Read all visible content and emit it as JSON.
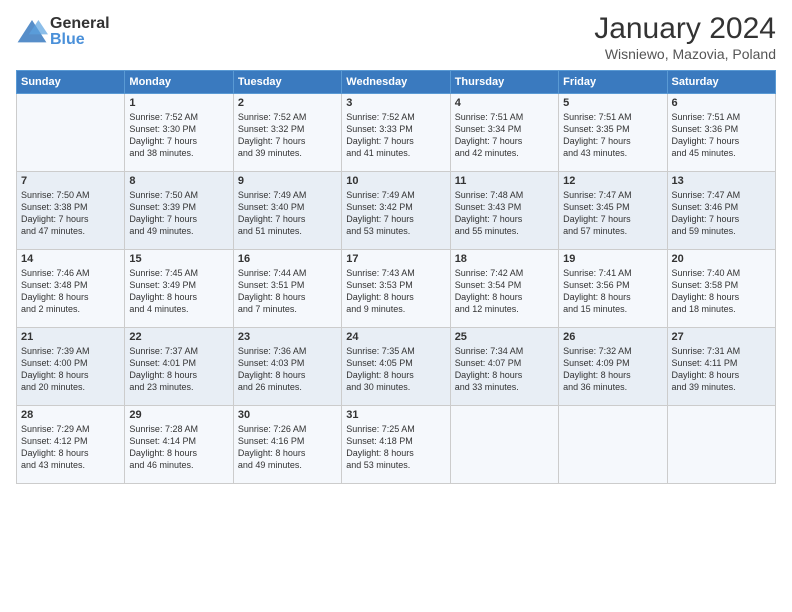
{
  "logo": {
    "general": "General",
    "blue": "Blue"
  },
  "title": "January 2024",
  "subtitle": "Wisniewo, Mazovia, Poland",
  "days_header": [
    "Sunday",
    "Monday",
    "Tuesday",
    "Wednesday",
    "Thursday",
    "Friday",
    "Saturday"
  ],
  "weeks": [
    [
      {
        "day": "",
        "info": ""
      },
      {
        "day": "1",
        "info": "Sunrise: 7:52 AM\nSunset: 3:30 PM\nDaylight: 7 hours\nand 38 minutes."
      },
      {
        "day": "2",
        "info": "Sunrise: 7:52 AM\nSunset: 3:32 PM\nDaylight: 7 hours\nand 39 minutes."
      },
      {
        "day": "3",
        "info": "Sunrise: 7:52 AM\nSunset: 3:33 PM\nDaylight: 7 hours\nand 41 minutes."
      },
      {
        "day": "4",
        "info": "Sunrise: 7:51 AM\nSunset: 3:34 PM\nDaylight: 7 hours\nand 42 minutes."
      },
      {
        "day": "5",
        "info": "Sunrise: 7:51 AM\nSunset: 3:35 PM\nDaylight: 7 hours\nand 43 minutes."
      },
      {
        "day": "6",
        "info": "Sunrise: 7:51 AM\nSunset: 3:36 PM\nDaylight: 7 hours\nand 45 minutes."
      }
    ],
    [
      {
        "day": "7",
        "info": "Sunrise: 7:50 AM\nSunset: 3:38 PM\nDaylight: 7 hours\nand 47 minutes."
      },
      {
        "day": "8",
        "info": "Sunrise: 7:50 AM\nSunset: 3:39 PM\nDaylight: 7 hours\nand 49 minutes."
      },
      {
        "day": "9",
        "info": "Sunrise: 7:49 AM\nSunset: 3:40 PM\nDaylight: 7 hours\nand 51 minutes."
      },
      {
        "day": "10",
        "info": "Sunrise: 7:49 AM\nSunset: 3:42 PM\nDaylight: 7 hours\nand 53 minutes."
      },
      {
        "day": "11",
        "info": "Sunrise: 7:48 AM\nSunset: 3:43 PM\nDaylight: 7 hours\nand 55 minutes."
      },
      {
        "day": "12",
        "info": "Sunrise: 7:47 AM\nSunset: 3:45 PM\nDaylight: 7 hours\nand 57 minutes."
      },
      {
        "day": "13",
        "info": "Sunrise: 7:47 AM\nSunset: 3:46 PM\nDaylight: 7 hours\nand 59 minutes."
      }
    ],
    [
      {
        "day": "14",
        "info": "Sunrise: 7:46 AM\nSunset: 3:48 PM\nDaylight: 8 hours\nand 2 minutes."
      },
      {
        "day": "15",
        "info": "Sunrise: 7:45 AM\nSunset: 3:49 PM\nDaylight: 8 hours\nand 4 minutes."
      },
      {
        "day": "16",
        "info": "Sunrise: 7:44 AM\nSunset: 3:51 PM\nDaylight: 8 hours\nand 7 minutes."
      },
      {
        "day": "17",
        "info": "Sunrise: 7:43 AM\nSunset: 3:53 PM\nDaylight: 8 hours\nand 9 minutes."
      },
      {
        "day": "18",
        "info": "Sunrise: 7:42 AM\nSunset: 3:54 PM\nDaylight: 8 hours\nand 12 minutes."
      },
      {
        "day": "19",
        "info": "Sunrise: 7:41 AM\nSunset: 3:56 PM\nDaylight: 8 hours\nand 15 minutes."
      },
      {
        "day": "20",
        "info": "Sunrise: 7:40 AM\nSunset: 3:58 PM\nDaylight: 8 hours\nand 18 minutes."
      }
    ],
    [
      {
        "day": "21",
        "info": "Sunrise: 7:39 AM\nSunset: 4:00 PM\nDaylight: 8 hours\nand 20 minutes."
      },
      {
        "day": "22",
        "info": "Sunrise: 7:37 AM\nSunset: 4:01 PM\nDaylight: 8 hours\nand 23 minutes."
      },
      {
        "day": "23",
        "info": "Sunrise: 7:36 AM\nSunset: 4:03 PM\nDaylight: 8 hours\nand 26 minutes."
      },
      {
        "day": "24",
        "info": "Sunrise: 7:35 AM\nSunset: 4:05 PM\nDaylight: 8 hours\nand 30 minutes."
      },
      {
        "day": "25",
        "info": "Sunrise: 7:34 AM\nSunset: 4:07 PM\nDaylight: 8 hours\nand 33 minutes."
      },
      {
        "day": "26",
        "info": "Sunrise: 7:32 AM\nSunset: 4:09 PM\nDaylight: 8 hours\nand 36 minutes."
      },
      {
        "day": "27",
        "info": "Sunrise: 7:31 AM\nSunset: 4:11 PM\nDaylight: 8 hours\nand 39 minutes."
      }
    ],
    [
      {
        "day": "28",
        "info": "Sunrise: 7:29 AM\nSunset: 4:12 PM\nDaylight: 8 hours\nand 43 minutes."
      },
      {
        "day": "29",
        "info": "Sunrise: 7:28 AM\nSunset: 4:14 PM\nDaylight: 8 hours\nand 46 minutes."
      },
      {
        "day": "30",
        "info": "Sunrise: 7:26 AM\nSunset: 4:16 PM\nDaylight: 8 hours\nand 49 minutes."
      },
      {
        "day": "31",
        "info": "Sunrise: 7:25 AM\nSunset: 4:18 PM\nDaylight: 8 hours\nand 53 minutes."
      },
      {
        "day": "",
        "info": ""
      },
      {
        "day": "",
        "info": ""
      },
      {
        "day": "",
        "info": ""
      }
    ]
  ]
}
